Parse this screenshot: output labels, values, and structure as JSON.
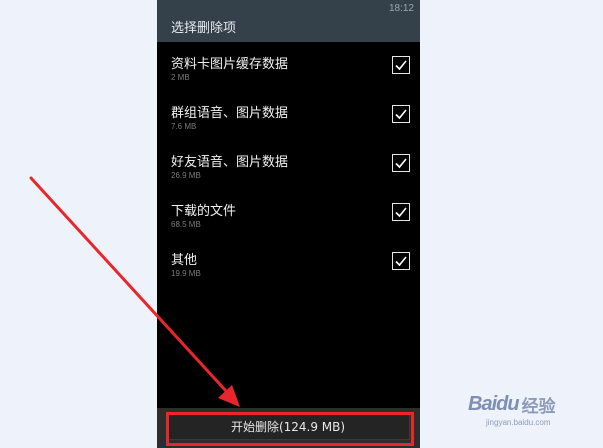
{
  "status_bar": {
    "time": "18:12"
  },
  "header": {
    "title": "选择删除项"
  },
  "items": [
    {
      "name": "资料卡图片缓存数据",
      "size": "2 MB",
      "checked": true
    },
    {
      "name": "群组语音、图片数据",
      "size": "7.6 MB",
      "checked": true
    },
    {
      "name": "好友语音、图片数据",
      "size": "26.9 MB",
      "checked": true
    },
    {
      "name": "下载的文件",
      "size": "68.5 MB",
      "checked": true
    },
    {
      "name": "其他",
      "size": "19.9 MB",
      "checked": true
    }
  ],
  "footer": {
    "start_label": "开始删除(124.9 MB)"
  },
  "annotation": {
    "highlight_color": "#e8262b"
  },
  "watermark": {
    "brand": "Baidu",
    "suffix": "经验",
    "url": "jingyan.baidu.com"
  }
}
